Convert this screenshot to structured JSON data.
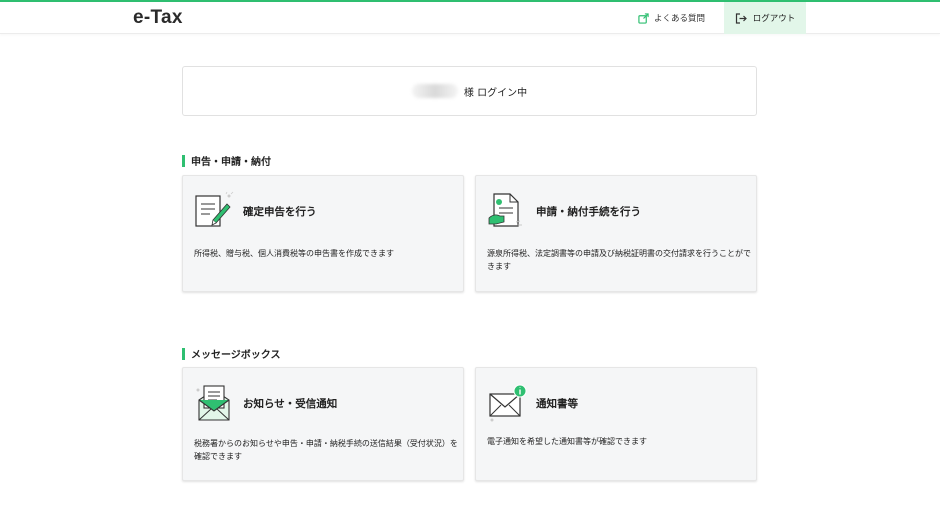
{
  "header": {
    "logo": "e-Tax",
    "faq_label": "よくある質問",
    "logout_label": "ログアウト"
  },
  "login_status": {
    "suffix": "様 ログイン中"
  },
  "sections": [
    {
      "title": "申告・申請・納付",
      "cards": [
        {
          "title": "確定申告を行う",
          "desc": "所得税、贈与税、個人消費税等の申告書を作成できます"
        },
        {
          "title": "申請・納付手続を行う",
          "desc": "源泉所得税、法定調書等の申請及び納税証明書の交付請求を行うことができます"
        }
      ]
    },
    {
      "title": "メッセージボックス",
      "cards": [
        {
          "title": "お知らせ・受信通知",
          "desc": "税務署からのお知らせや申告・申請・納税手続の送信結果（受付状況）を確認できます"
        },
        {
          "title": "通知書等",
          "desc": "電子通知を希望した通知書等が確認できます"
        }
      ]
    }
  ],
  "colors": {
    "accent": "#2fbf71",
    "logout_bg": "#e2f6e9",
    "card_bg": "#f5f6f7"
  }
}
